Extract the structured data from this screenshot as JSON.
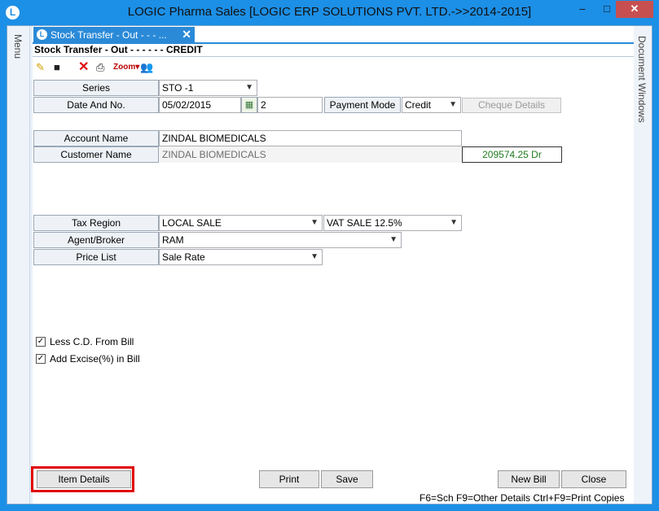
{
  "window": {
    "title": "LOGIC Pharma Sales  [LOGIC ERP SOLUTIONS PVT. LTD.->>2014-2015]",
    "app_icon": "L",
    "minimize": "–",
    "maximize": "□",
    "close": "✕"
  },
  "side": {
    "menu_label": "Menu",
    "docwin_label": "Document Windows"
  },
  "tab": {
    "icon": "L",
    "label": "Stock Transfer - Out -  - - ...",
    "close": "✕"
  },
  "form": {
    "header": "Stock Transfer - Out -  - - - -  - CREDIT",
    "toolbar": {
      "new_icon": "✎",
      "save_icon": "■",
      "delete_icon": "✕",
      "print_icon": "⎙",
      "zoom_icon": "Zoom▾",
      "users_icon": "👥"
    },
    "series": {
      "label": "Series",
      "value": "STO -1"
    },
    "date": {
      "label": "Date And No.",
      "value": "05/02/2015",
      "cal_icon": "▦",
      "number": "2"
    },
    "payment": {
      "label": "Payment Mode",
      "value": "Credit",
      "cheque_button": "Cheque Details"
    },
    "account": {
      "label": "Account Name",
      "value": "ZINDAL BIOMEDICALS"
    },
    "customer": {
      "label": "Customer Name",
      "value": "ZINDAL BIOMEDICALS",
      "balance": "209574.25 Dr"
    },
    "tax_region": {
      "label": "Tax Region",
      "value": "LOCAL SALE",
      "vat": "VAT SALE 12.5%"
    },
    "agent": {
      "label": "Agent/Broker",
      "value": "RAM"
    },
    "price_list": {
      "label": "Price List",
      "value": "Sale Rate"
    },
    "checkboxes": [
      {
        "label": "Less C.D. From Bill",
        "checked_mark": "✓"
      },
      {
        "label": "Add Excise(%) in Bill",
        "checked_mark": "✓"
      }
    ],
    "buttons": {
      "item_details": "Item Details",
      "print": "Print",
      "save": "Save",
      "new_bill": "New Bill",
      "close": "Close"
    },
    "hotkeys": "F6=Sch F9=Other Details Ctrl+F9=Print Copies"
  },
  "colors": {
    "accent": "#1c8fe6",
    "highlight": "#e00000",
    "balance_text": "#1f7a1f"
  }
}
